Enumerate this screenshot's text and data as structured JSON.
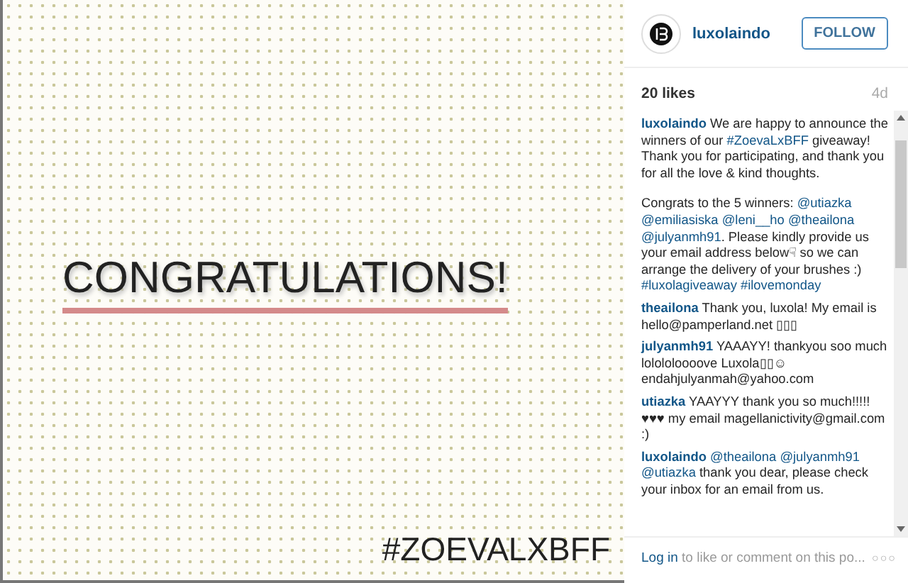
{
  "post_image": {
    "headline": "CONGRATULATIONS!",
    "hashtag": "#ZOEVALXBFF"
  },
  "header": {
    "username": "luxolaindo",
    "follow_button": "FOLLOW"
  },
  "likes": "20 likes",
  "age": "4d",
  "comments": [
    {
      "user": "luxolaindo",
      "parts": [
        {
          "kind": "plain",
          "text": "We are happy to announce the winners of our "
        },
        {
          "kind": "link",
          "text": "#ZoevaLxBFF"
        },
        {
          "kind": "plain",
          "text": " giveaway! Thank you for participating, and thank you for all the love & kind thoughts."
        },
        {
          "kind": "break"
        },
        {
          "kind": "plain",
          "text": "Congrats to the 5 winners: "
        },
        {
          "kind": "link",
          "text": "@utiazka"
        },
        {
          "kind": "link",
          "text": "@emiliasiska"
        },
        {
          "kind": "link",
          "text": "@leni__ho"
        },
        {
          "kind": "link",
          "text": "@theailona"
        },
        {
          "kind": "link",
          "text": "@julyanmh91"
        },
        {
          "kind": "plain",
          "text": ". Please kindly provide us your email address below☟ so we can arrange the delivery of your brushes :) "
        },
        {
          "kind": "link",
          "text": "#luxolagiveaway"
        },
        {
          "kind": "link",
          "text": "#ilovemonday"
        }
      ]
    },
    {
      "user": "theailona",
      "parts": [
        {
          "kind": "plain",
          "text": "Thank you, luxola! My email is hello@pamperland.net ▯▯▯"
        }
      ]
    },
    {
      "user": "julyanmh91",
      "parts": [
        {
          "kind": "plain",
          "text": "YAAAYY! thankyou soo much lolololoooove Luxola▯▯☺ endahjulyanmah@yahoo.com"
        }
      ]
    },
    {
      "user": "utiazka",
      "parts": [
        {
          "kind": "plain",
          "text": "YAAYYY thank you so much!!!!! ♥♥♥ my email magellanictivity@gmail.com :)"
        }
      ]
    },
    {
      "user": "luxolaindo",
      "parts": [
        {
          "kind": "link",
          "text": "@theailona"
        },
        {
          "kind": "link",
          "text": "@julyanmh91"
        },
        {
          "kind": "link",
          "text": "@utiazka"
        },
        {
          "kind": "plain",
          "text": " thank you dear, please check your inbox for an email from us."
        }
      ]
    }
  ],
  "footer": {
    "login_link": "Log in",
    "prompt": " to like or comment on this po...",
    "more": "○○○"
  }
}
